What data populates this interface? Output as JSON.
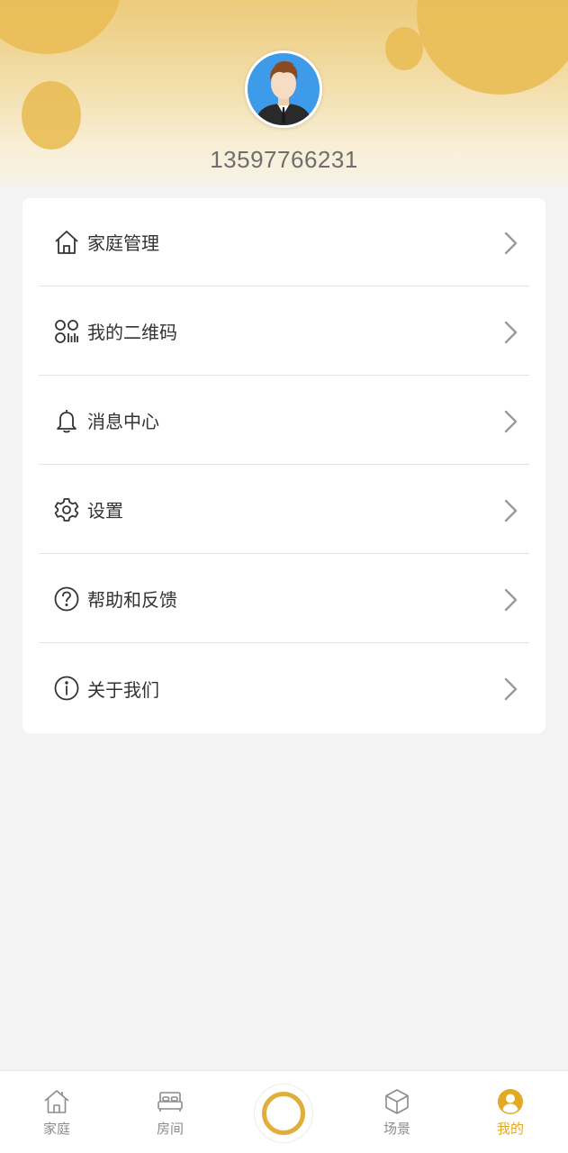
{
  "profile": {
    "phone": "13597766231",
    "avatar_icon": "user-avatar-icon"
  },
  "menu": {
    "items": [
      {
        "label": "家庭管理",
        "icon": "home-icon"
      },
      {
        "label": "我的二维码",
        "icon": "qrcode-icon"
      },
      {
        "label": "消息中心",
        "icon": "bell-icon"
      },
      {
        "label": "设置",
        "icon": "gear-icon"
      },
      {
        "label": "帮助和反馈",
        "icon": "question-icon"
      },
      {
        "label": "关于我们",
        "icon": "info-icon"
      }
    ]
  },
  "tabbar": {
    "tabs": [
      {
        "label": "家庭",
        "icon": "home-icon",
        "active": false
      },
      {
        "label": "房间",
        "icon": "bed-icon",
        "active": false
      },
      {
        "label": "场景",
        "icon": "cube-icon",
        "active": false
      },
      {
        "label": "我的",
        "icon": "user-icon",
        "active": true
      }
    ],
    "center_icon": "ring-icon"
  },
  "colors": {
    "accent": "#e3a824",
    "header_blob": "#e9bd55",
    "background": "#f3f3f3"
  }
}
